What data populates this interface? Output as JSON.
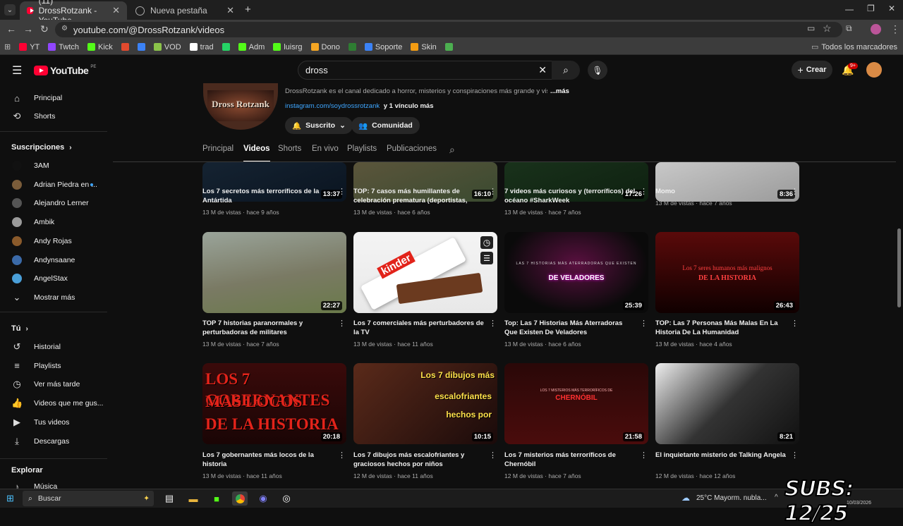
{
  "browser": {
    "tabs": [
      {
        "label": "(11) DrossRotzank - YouTube",
        "active": true
      },
      {
        "label": "Nueva pestaña",
        "active": false
      }
    ],
    "url": "youtube.com/@DrossRotzank/videos",
    "bookmarks": [
      {
        "label": "YT",
        "color": "#ff0033"
      },
      {
        "label": "Twtch",
        "color": "#9146ff"
      },
      {
        "label": "Kick",
        "color": "#53fc18"
      },
      {
        "label": "",
        "color": "#e24a2e"
      },
      {
        "label": "",
        "color": "#3b82f6"
      },
      {
        "label": "VOD",
        "color": "#8bc34a"
      },
      {
        "label": "trad",
        "color": "#ffffff"
      },
      {
        "label": "",
        "color": "#25d366"
      },
      {
        "label": "Adm",
        "color": "#53fc18"
      },
      {
        "label": "luisrg",
        "color": "#53fc18"
      },
      {
        "label": "Dono",
        "color": "#f5a623"
      },
      {
        "label": "",
        "color": "#2e7d32"
      },
      {
        "label": "Soporte",
        "color": "#3b82f6"
      },
      {
        "label": "Skin",
        "color": "#f39c12"
      },
      {
        "label": "",
        "color": "#4caf50"
      }
    ],
    "all_bookmarks": "Todos los marcadores"
  },
  "youtube": {
    "logo": "YouTube",
    "region": "PE",
    "search_value": "dross",
    "create_label": "Crear",
    "notif_count": "9+"
  },
  "sidebar": {
    "top": [
      {
        "label": "Principal",
        "icon": "home-icon"
      },
      {
        "label": "Shorts",
        "icon": "shorts-icon"
      }
    ],
    "subs_title": "Suscripciones",
    "subs": [
      {
        "label": "3AM",
        "color": "#111"
      },
      {
        "label": "Adrian Piedra en ...",
        "color": "#7a5c3a"
      },
      {
        "label": "Alejandro Lerner",
        "color": "#555"
      },
      {
        "label": "Ambik",
        "color": "#9a9a9a"
      },
      {
        "label": "Andy Rojas",
        "color": "#8a5a2b"
      },
      {
        "label": "Andynsaane",
        "color": "#3b6aa8"
      },
      {
        "label": "AngelStax",
        "color": "#4a9fd8"
      }
    ],
    "show_more": "Mostrar más",
    "you_title": "Tú",
    "you": [
      {
        "label": "Historial",
        "icon": "history-icon"
      },
      {
        "label": "Playlists",
        "icon": "playlists-icon"
      },
      {
        "label": "Ver más tarde",
        "icon": "watch-later-icon"
      },
      {
        "label": "Videos que me gus...",
        "icon": "like-icon"
      },
      {
        "label": "Tus videos",
        "icon": "your-videos-icon"
      },
      {
        "label": "Descargas",
        "icon": "downloads-icon"
      }
    ],
    "explore_title": "Explorar",
    "music": "Música"
  },
  "channel": {
    "avatar_text": "Dross Rotzank",
    "description": "DrossRotzank es el canal dedicado a horror, misterios y conspiraciones más grande y vist",
    "more": "...más",
    "link": "instagram.com/soydrossrotzank",
    "link_more": "y 1 vínculo más",
    "subscribed": "Suscrito",
    "community": "Comunidad",
    "tabs": [
      "Principal",
      "Videos",
      "Shorts",
      "En vivo",
      "Playlists",
      "Publicaciones"
    ]
  },
  "videos_row0": [
    {
      "title": "Los 7 secretos más terroríficos de la Antártida",
      "meta": "13 M de vistas · hace 9 años",
      "duration": "13:37"
    },
    {
      "title": "TOP: 7 casos más humillantes de celebración prematura (deportistas, gamer...",
      "meta": "13 M de vistas · hace 6 años",
      "duration": "16:10"
    },
    {
      "title": "7 videos más curiosos y (terroríficos) del océano #SharkWeek",
      "meta": "13 M de vistas · hace 7 años",
      "duration": "17:26"
    },
    {
      "title": "Momo",
      "meta": "13 M de vistas · hace 7 años",
      "duration": "8:36"
    }
  ],
  "videos_row1": [
    {
      "title": "TOP 7 historias paranormales y perturbadoras de militares",
      "meta": "13 M de vistas · hace 7 años",
      "duration": "22:27"
    },
    {
      "title": "Los 7 comerciales más perturbadores de la TV",
      "meta": "13 M de vistas · hace 11 años",
      "duration": "",
      "thumb_text": "kinder"
    },
    {
      "title": "Top: Las 7 Historias Más Aterradoras Que Existen De Veladores",
      "meta": "13 M de vistas · hace 6 años",
      "duration": "25:39",
      "thumb_text": "LAS 7 HISTORIAS MÁS ATERRADORAS QUE EXISTEN",
      "thumb_text2": "DE VELADORES"
    },
    {
      "title": "TOP: Las 7 Personas Más Malas En La Historia De La Humanidad",
      "meta": "13 M de vistas · hace 4 años",
      "duration": "26:43",
      "thumb_text": "Los 7 seres humanos más malignos",
      "thumb_text2": "DE LA HISTORIA"
    }
  ],
  "videos_row2": [
    {
      "title": "Los 7 gobernantes más locos de la historia",
      "meta": "13 M de vistas · hace 11 años",
      "duration": "20:18",
      "thumb_text": "LOS 7 GOBERNANTES",
      "thumb_text2": "MAS LOCOS",
      "thumb_text3": "DE LA HISTORIA"
    },
    {
      "title": "Los 7 dibujos más escalofriantes y graciosos hechos por niños",
      "meta": "12 M de vistas · hace 11 años",
      "duration": "10:15",
      "thumb_text": "Los 7 dibujos más",
      "thumb_text2": "escalofriantes",
      "thumb_text3": "hechos por"
    },
    {
      "title": "Los 7 misterios más terroríficos de Chernóbil",
      "meta": "12 M de vistas · hace 7 años",
      "duration": "21:58",
      "thumb_text": "LOS 7 MISTERIOS MÁS TERRORÍFICOS DE",
      "thumb_text2": "CHERNÓBIL"
    },
    {
      "title": "El inquietante misterio de Talking Angela",
      "meta": "12 M de vistas · hace 12 años",
      "duration": "8:21"
    }
  ],
  "taskbar": {
    "search": "Buscar",
    "weather": "25°C  Mayorm. nubla...",
    "date": "10/03/2026"
  },
  "overlay": {
    "subs": "SUBS: 12/25"
  }
}
